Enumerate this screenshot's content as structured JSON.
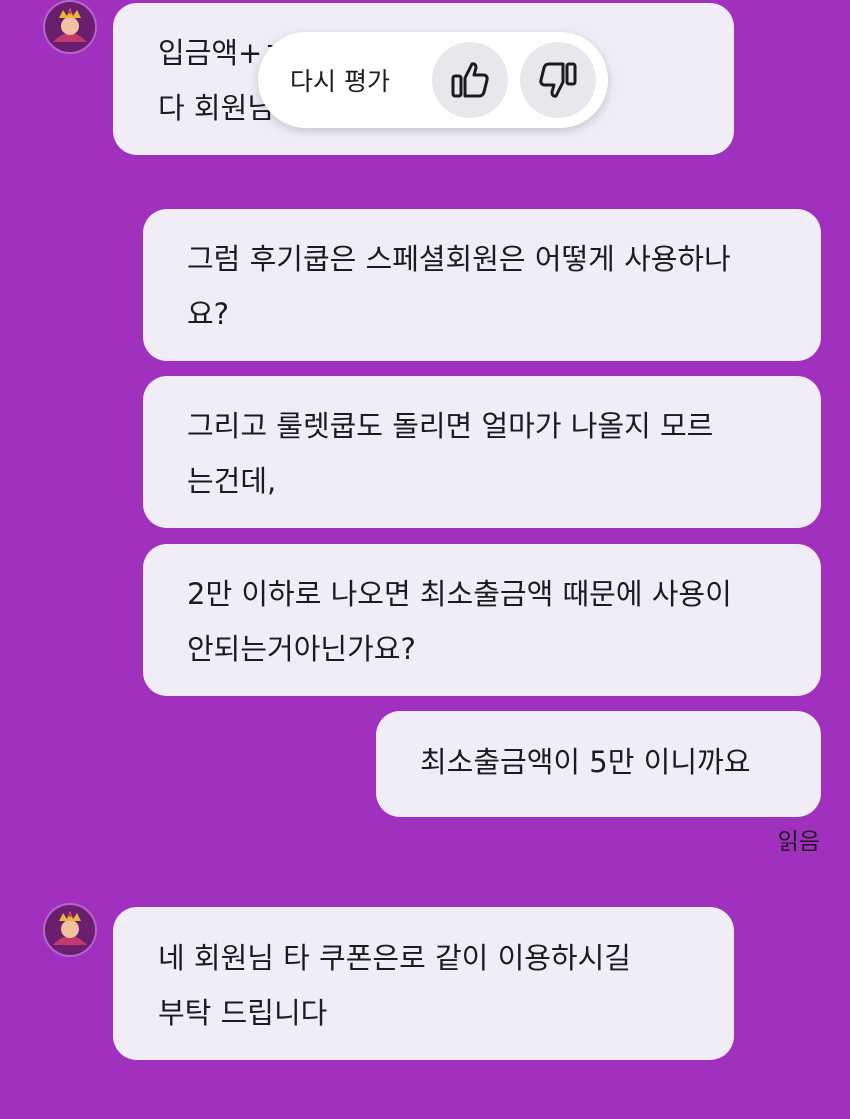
{
  "rating_popup": {
    "label": "다시 평가",
    "thumbs_up_icon": "thumbs-up-icon",
    "thumbs_down_icon": "thumbs-down-icon"
  },
  "messages": [
    {
      "sender": "agent",
      "lines": [
        "입금액+ㅋ 가합니",
        "다 회원님"
      ]
    },
    {
      "sender": "user",
      "lines": [
        "그럼 후기쿱은 스페셜회원은 어떻게 사용하나",
        "요?"
      ]
    },
    {
      "sender": "user",
      "lines": [
        "그리고 룰렛쿱도 돌리면 얼마가 나올지 모르",
        "는건데,"
      ]
    },
    {
      "sender": "user",
      "lines": [
        "2만 이하로 나오면 최소출금액 때문에 사용이",
        "안되는거아닌가요?"
      ]
    },
    {
      "sender": "user",
      "lines": [
        "최소출금액이 5만 이니까요"
      ]
    },
    {
      "sender": "agent",
      "lines": [
        "네 회원님 타 쿠폰은로 같이 이용하시길",
        "부탁 드립니다"
      ]
    }
  ],
  "read_receipt": "읽음",
  "colors": {
    "background": "#a031bf",
    "bubble": "#f1edf6",
    "popup": "#ffffff",
    "text": "#1c1b1f"
  }
}
